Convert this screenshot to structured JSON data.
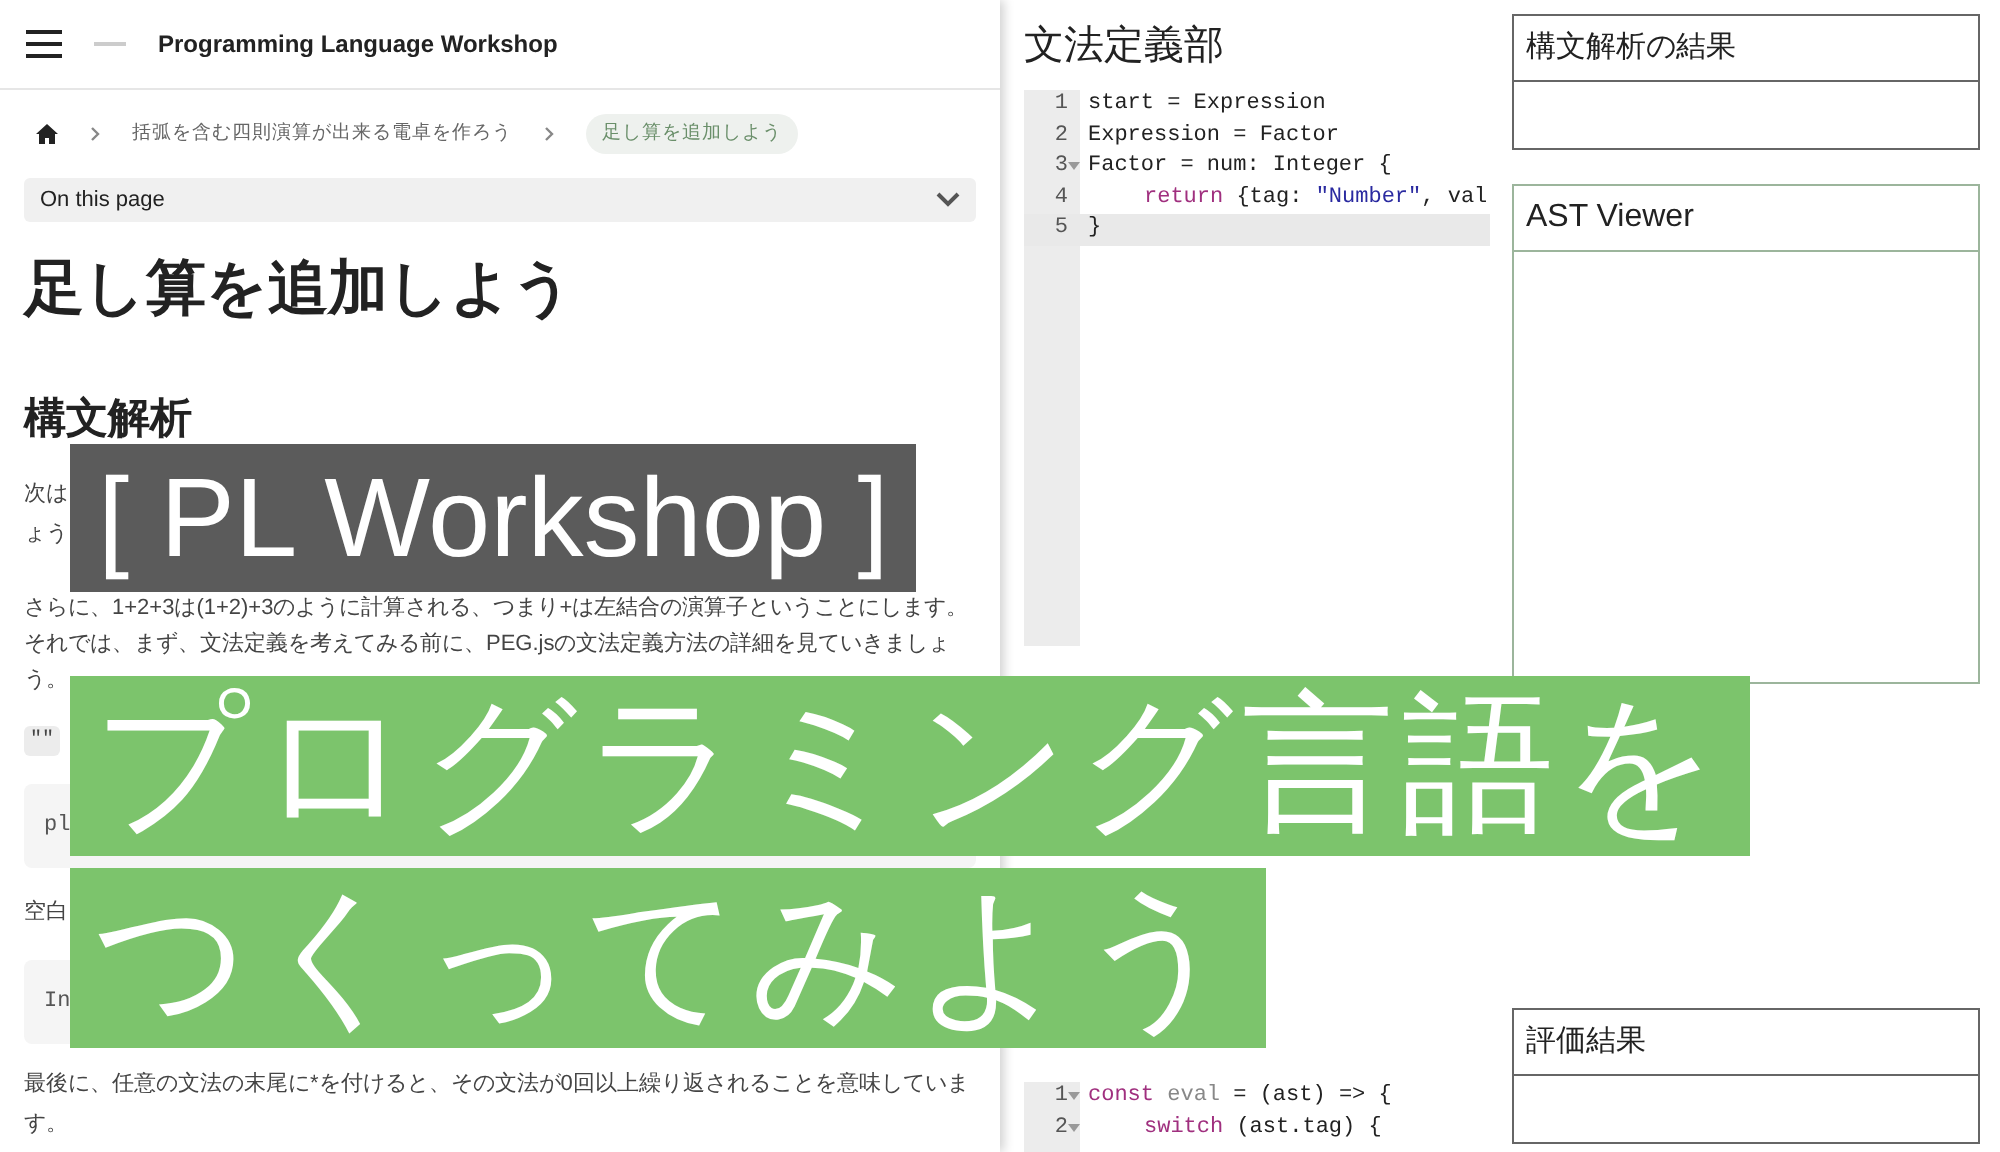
{
  "header": {
    "title": "Programming Language Workshop"
  },
  "breadcrumb": [
    {
      "label": "括弧を含む四則演算が出来る電卓を作ろう",
      "selected": false
    },
    {
      "label": "足し算を追加しよう",
      "selected": true
    }
  ],
  "toc": {
    "label": "On this page"
  },
  "heading": "足し算を追加しよう",
  "section_heading": "構文解析",
  "content": [
    {
      "kind": "fragments",
      "texts": [
        "次は",
        "ょう"
      ]
    },
    {
      "kind": "paragraph",
      "text": "さらに、1+2+3は(1+2)+3のように計算される、つまり+は左結合の演算子ということにします。それでは、まず、文法定義を考えてみる前に、PEG.jsの文法定義方法の詳細を見ていきましょう。"
    },
    {
      "kind": "inline_code",
      "text": "\"\""
    },
    {
      "kind": "code",
      "text": "pl"
    },
    {
      "kind": "fragments",
      "texts": [
        "空白"
      ]
    },
    {
      "kind": "code",
      "text": "In"
    },
    {
      "kind": "paragraph",
      "text": "最後に、任意の文法の末尾に*を付けると、その文法が0回以上繰り返されることを意味しています。"
    }
  ],
  "grammar_editor": {
    "title": "文法定義部",
    "lines": [
      {
        "number": "1",
        "foldable": false,
        "indented": false,
        "active": false,
        "tokens": [
          {
            "kind": "plain",
            "text": "start = Expression"
          }
        ]
      },
      {
        "number": "2",
        "foldable": false,
        "indented": false,
        "active": false,
        "tokens": [
          {
            "kind": "plain",
            "text": "Expression = Factor"
          }
        ]
      },
      {
        "number": "3",
        "foldable": true,
        "indented": false,
        "active": false,
        "tokens": [
          {
            "kind": "plain",
            "text": "Factor = num: Integer {"
          }
        ]
      },
      {
        "number": "4",
        "foldable": false,
        "indented": true,
        "active": false,
        "tokens": [
          {
            "kind": "keyword",
            "text": "return"
          },
          {
            "kind": "plain",
            "text": " {tag: "
          },
          {
            "kind": "string",
            "text": "\"Number\""
          },
          {
            "kind": "plain",
            "text": ", val"
          }
        ]
      },
      {
        "number": "5",
        "foldable": false,
        "indented": false,
        "active": true,
        "tokens": [
          {
            "kind": "plain",
            "text": "}"
          }
        ]
      }
    ]
  },
  "eval_editor": {
    "lines": [
      {
        "number": "1",
        "foldable": true,
        "indented": false,
        "active": false,
        "tokens": [
          {
            "kind": "keyword",
            "text": "const"
          },
          {
            "kind": "variable",
            "text": " eval"
          },
          {
            "kind": "plain",
            "text": " = (ast) => {"
          }
        ]
      },
      {
        "number": "2",
        "foldable": true,
        "indented": true,
        "active": false,
        "tokens": [
          {
            "kind": "keyword",
            "text": "switch"
          },
          {
            "kind": "plain",
            "text": " (ast.tag) {"
          }
        ]
      }
    ]
  },
  "parse_result": {
    "title": "構文解析の結果"
  },
  "ast_viewer": {
    "title": "AST Viewer"
  },
  "eval_result": {
    "title": "評価結果"
  },
  "overlay_titles": [
    {
      "kind": "dark",
      "text": "[ PL Workshop ]"
    },
    {
      "kind": "green",
      "text": "プログラミング言語を"
    },
    {
      "kind": "green",
      "text": "つくってみよう"
    }
  ]
}
